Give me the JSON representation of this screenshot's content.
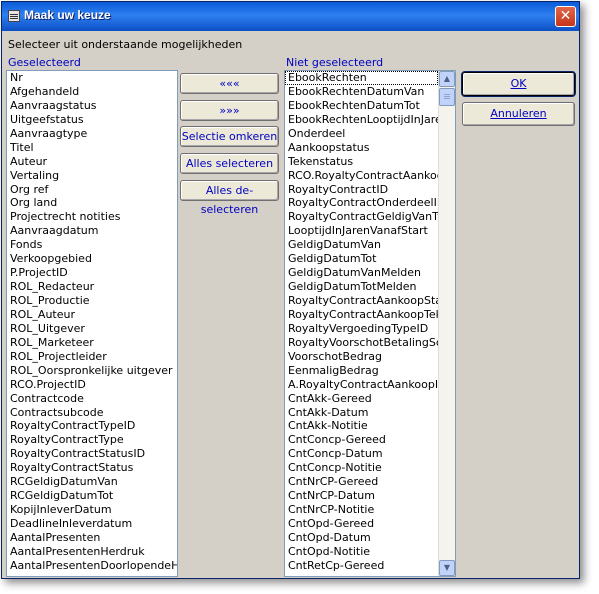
{
  "window": {
    "title": "Maak uw keuze",
    "close_symbol": "✕"
  },
  "instruction": "Selecteer uit onderstaande mogelijkheden",
  "selected_header": "Geselecteerd",
  "unselected_header": "Niet geselecteerd",
  "buttons": {
    "move_all_left": "«««",
    "move_all_right": "»»»",
    "invert_selection": "Selectie omkeren",
    "select_all": "Alles selecteren",
    "deselect_all": "Alles de-selecteren",
    "ok": "OK",
    "cancel": "Annuleren"
  },
  "scrollbar": {
    "up_symbol": "▲",
    "down_symbol": "▼"
  },
  "selected_items": [
    "Nr",
    "Afgehandeld",
    "Aanvraagstatus",
    "Uitgeefstatus",
    "Aanvraagtype",
    "Titel",
    "Auteur",
    "Vertaling",
    "Org ref",
    "Org land",
    "Projectrecht notities",
    "Aanvraagdatum",
    "Fonds",
    "Verkoopgebied",
    "P.ProjectID",
    "ROL_Redacteur",
    "ROL_Productie",
    "ROL_Auteur",
    "ROL_Uitgever",
    "ROL_Marketeer",
    "ROL_Projectleider",
    "ROL_Oorspronkelijke uitgever",
    "RCO.ProjectID",
    "Contractcode",
    "Contractsubcode",
    "RoyaltyContractTypeID",
    "RoyaltyContractType",
    "RoyaltyContractStatusID",
    "RoyaltyContractStatus",
    "RCGeldigDatumVan",
    "RCGeldigDatumTot",
    "KopijInleverDatum",
    "DeadlineInleverdatum",
    "AantalPresenten",
    "AantalPresentenHerdruk",
    "AantalPresentenDoorlopendeHerd"
  ],
  "unselected_items": [
    "EbookRechten",
    "EbookRechtenDatumVan",
    "EbookRechtenDatumTot",
    "EbookRechtenLooptijdInJaren",
    "Onderdeel",
    "Aankoopstatus",
    "Tekenstatus",
    "RCO.RoyaltyContractAankoopI",
    "RoyaltyContractID",
    "RoyaltyContractOnderdeelID",
    "RoyaltyContractGeldigVanType",
    "LooptijdInJarenVanafStart",
    "GeldigDatumVan",
    "GeldigDatumTot",
    "GeldigDatumVanMelden",
    "GeldigDatumTotMelden",
    "RoyaltyContractAankoopStatus",
    "RoyaltyContractAankoopTeken",
    "RoyaltyVergoedingTypeID",
    "RoyaltyVoorschotBetalingScena",
    "VoorschotBedrag",
    "EenmaligBedrag",
    "A.RoyaltyContractAankoopID",
    "CntAkk-Gereed",
    "CntAkk-Datum",
    "CntAkk-Notitie",
    "CntConcp-Gereed",
    "CntConcp-Datum",
    "CntConcp-Notitie",
    "CntNrCP-Gereed",
    "CntNrCP-Datum",
    "CntNrCP-Notitie",
    "CntOpd-Gereed",
    "CntOpd-Datum",
    "CntOpd-Notitie",
    "CntRetCp-Gereed"
  ]
}
